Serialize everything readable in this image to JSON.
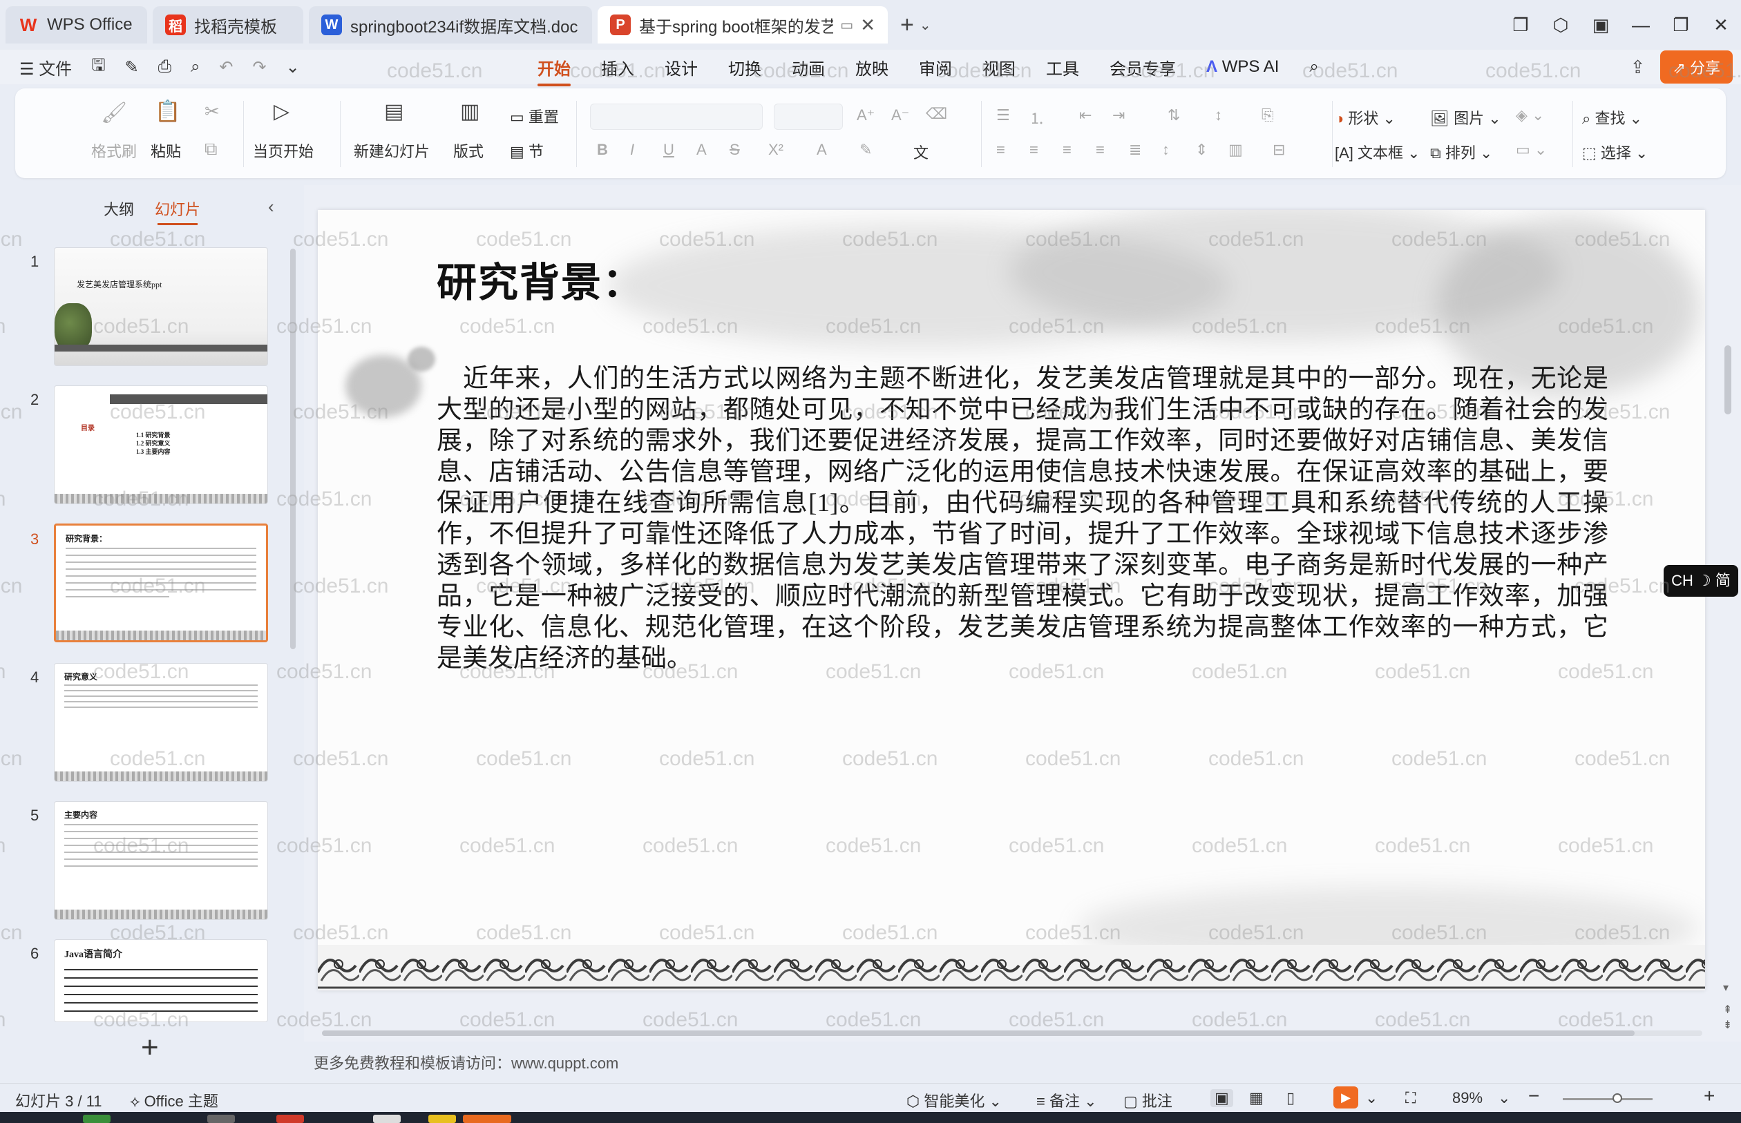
{
  "tabs": [
    {
      "label": "WPS Office",
      "icon": "wps-logo-icon",
      "color": "#e8341c"
    },
    {
      "label": "找稻壳模板",
      "icon": "docer-logo-icon",
      "color": "#e8341c"
    },
    {
      "label": "springboot234if数据库文档.doc",
      "icon": "word-doc-icon",
      "color": "#2b5fd9"
    },
    {
      "label": "基于spring boot框架的发艺",
      "icon": "ppt-doc-icon",
      "color": "#d9442b",
      "active": true
    }
  ],
  "menu": {
    "file": "文件",
    "tabs": [
      "开始",
      "插入",
      "设计",
      "切换",
      "动画",
      "放映",
      "审阅",
      "视图",
      "工具",
      "会员专享"
    ],
    "active_tab": "开始",
    "wps_ai": "WPS AI",
    "share": "分享"
  },
  "ribbon": {
    "format_painter": "格式刷",
    "paste": "粘贴",
    "start_from_current": "当页开始",
    "new_slide": "新建幻灯片",
    "layout": "版式",
    "reset": "重置",
    "section": "节",
    "shape": "形状",
    "picture": "图片",
    "find": "查找",
    "textbox": "文本框",
    "arrange": "排列",
    "select": "选择"
  },
  "left_pane": {
    "tab_outline": "大纲",
    "tab_slides": "幻灯片",
    "thumbnails": [
      {
        "num": "1",
        "title": "发艺美发店管理系统ppt"
      },
      {
        "num": "2",
        "title": "目录",
        "items": [
          "1.1 研究背景",
          "1.2 研究意义",
          "1.3 主要内容"
        ]
      },
      {
        "num": "3",
        "title": "研究背景：",
        "active": true
      },
      {
        "num": "4",
        "title": "研究意义"
      },
      {
        "num": "5",
        "title": "主要内容"
      },
      {
        "num": "6",
        "title": "Java语言简介"
      }
    ]
  },
  "slide": {
    "title": "研究背景：",
    "body": "近年来，人们的生活方式以网络为主题不断进化，发艺美发店管理就是其中的一部分。现在，无论是大型的还是小型的网站，都随处可见，不知不觉中已经成为我们生活中不可或缺的存在。随着社会的发展，除了对系统的需求外，我们还要促进经济发展，提高工作效率，同时还要做好对店铺信息、美发信息、店铺活动、公告信息等管理，网络广泛化的运用使信息技术快速发展。在保证高效率的基础上，要保证用户便捷在线查询所需信息[1]。目前，由代码编程实现的各种管理工具和系统替代传统的人工操作，不但提升了可靠性还降低了人力成本，节省了时间，提升了工作效率。全球视域下信息技术逐步渗透到各个领域，多样化的数据信息为发艺美发店管理带来了深刻变革。电子商务是新时代发展的一种产品，它是一种被广泛接受的、顺应时代潮流的新型管理模式。它有助于改变现状，提高工作效率，加强专业化、信息化、规范化管理，在这个阶段，发艺美发店管理系统为提高整体工作效率的一种方式，它是美发店经济的基础。"
  },
  "notes": "更多免费教程和模板请访问：www.quppt.com",
  "ime": "CH ☽ 简",
  "status": {
    "slide_counter": "幻灯片 3 / 11",
    "theme": "Office 主题",
    "beautify": "智能美化",
    "notes": "备注",
    "comment": "批注",
    "zoom": "89%"
  },
  "watermark": "code51.cn",
  "colors": {
    "accent": "#d0501e",
    "share": "#f06a21"
  }
}
